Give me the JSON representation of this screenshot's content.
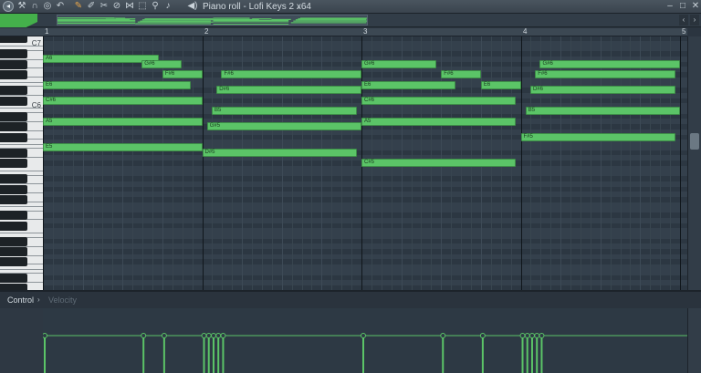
{
  "toolbar": {
    "icons": [
      "menu-icon",
      "wrench-icon",
      "magnet-icon",
      "snap-icon",
      "undo-icon",
      "pencil-icon",
      "brush-icon",
      "delete-icon",
      "mute-icon",
      "slice-icon",
      "select-icon",
      "zoom-icon",
      "playback-icon"
    ],
    "title": "Piano roll - Lofi Keys 2 x64",
    "title_arrow": "›"
  },
  "ruler": {
    "bars": [
      "1",
      "2",
      "3",
      "4",
      "5"
    ]
  },
  "keyboard": {
    "labels": [
      "C7",
      "C6"
    ]
  },
  "notes": [
    {
      "label": "A6",
      "bar": 1.0,
      "len": 0.73,
      "row": "A6"
    },
    {
      "label": "G#6",
      "bar": 1.62,
      "len": 0.25,
      "row": "G#6"
    },
    {
      "label": "F#6",
      "bar": 1.75,
      "len": 0.25,
      "row": "F#6"
    },
    {
      "label": "E6",
      "bar": 1.0,
      "len": 0.93,
      "row": "E6"
    },
    {
      "label": "C#6",
      "bar": 1.0,
      "len": 1.0,
      "row": "C#6"
    },
    {
      "label": "A5",
      "bar": 1.0,
      "len": 1.0,
      "row": "A5"
    },
    {
      "label": "E5",
      "bar": 1.0,
      "len": 1.0,
      "row": "E5"
    },
    {
      "label": "F#6",
      "bar": 2.12,
      "len": 0.88,
      "row": "F#6"
    },
    {
      "label": "D#6",
      "bar": 2.09,
      "len": 0.91,
      "row": "D#6"
    },
    {
      "label": "B5",
      "bar": 2.06,
      "len": 0.91,
      "row": "B5"
    },
    {
      "label": "G#5",
      "bar": 2.03,
      "len": 0.97,
      "row": "G#5"
    },
    {
      "label": "D#5",
      "bar": 2.0,
      "len": 0.97,
      "row": "D#5"
    },
    {
      "label": "G#6",
      "bar": 3.0,
      "len": 0.47,
      "row": "G#6"
    },
    {
      "label": "F#6",
      "bar": 3.5,
      "len": 0.25,
      "row": "F#6"
    },
    {
      "label": "E6",
      "bar": 3.0,
      "len": 0.59,
      "row": "E6"
    },
    {
      "label": "E6",
      "bar": 3.75,
      "len": 0.25,
      "row": "E6"
    },
    {
      "label": "C#6",
      "bar": 3.0,
      "len": 0.97,
      "row": "C#6"
    },
    {
      "label": "A5",
      "bar": 3.0,
      "len": 0.97,
      "row": "A5"
    },
    {
      "label": "C#5",
      "bar": 3.0,
      "len": 0.97,
      "row": "C#5"
    },
    {
      "label": "G#6",
      "bar": 4.12,
      "len": 0.88,
      "row": "G#6"
    },
    {
      "label": "F#6",
      "bar": 4.09,
      "len": 0.88,
      "row": "F#6"
    },
    {
      "label": "D#6",
      "bar": 4.06,
      "len": 0.91,
      "row": "D#6"
    },
    {
      "label": "B5",
      "bar": 4.03,
      "len": 0.97,
      "row": "B5"
    },
    {
      "label": "F#5",
      "bar": 4.0,
      "len": 0.97,
      "row": "F#5"
    }
  ],
  "control": {
    "label": "Control",
    "arrow": "›",
    "target": "Velocity"
  },
  "colors": {
    "note": "#5bc467",
    "accent": "#44b04b",
    "grid": "#34404c"
  }
}
